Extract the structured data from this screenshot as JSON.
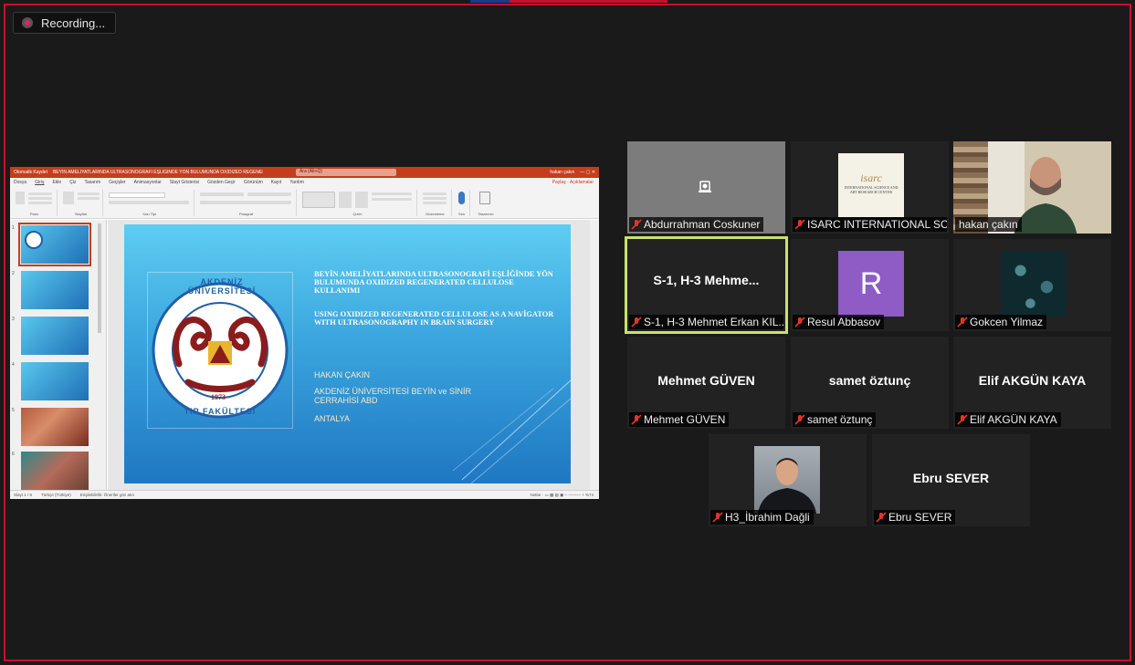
{
  "recording": {
    "label": "Recording..."
  },
  "colors": {
    "frame_border": "#c8102e",
    "recording_dot": "#e0245e",
    "speaker_highlight": "#c7e36a",
    "ppt_accent": "#c43e1c",
    "mute_icon": "#e5332a"
  },
  "shared_screen": {
    "app": "PowerPoint",
    "titlebar": {
      "autosave": "Otomatik Kaydet",
      "doc_title": "BEYİN AMELİYATLARINDA ULTRASONOGRAFİ EŞLİĞİNDE YÖN BULUMUNDA OXIDIZED REGENERATED - Bu bilgisayar konumuna kaydedildi",
      "search": "Ara (Alt+Q)",
      "user": "hakan çakın"
    },
    "menu": [
      "Dosya",
      "Giriş",
      "Ekle",
      "Çiz",
      "Tasarım",
      "Geçişler",
      "Animasyonlar",
      "Slayt Gösterisi",
      "Gözden Geçir",
      "Görünüm",
      "Kayıt",
      "Yardım"
    ],
    "share_label": "Paylaş",
    "comments_label": "Açıklamalar",
    "ribbon_groups": [
      "Pano",
      "Slaytlar",
      "Yazı Tipi",
      "Paragraf",
      "Çizim",
      "Düzenleme",
      "Ses",
      "Tasarımcı"
    ],
    "slide_numbers": [
      "1",
      "2",
      "3",
      "4",
      "5",
      "6"
    ],
    "slide": {
      "heading_tr": "BEYİN AMELİYATLARINDA ULTRASONOGRAFİ EŞLİĞİNDE YÖN BULUMUNDA OXIDIZED REGENERATED CELLULOSE KULLANIMI",
      "heading_en": "USING OXIDIZED REGENERATED CELLULOSE AS A NAVİGATOR WITH ULTRASONOGRAPHY IN BRAIN SURGERY",
      "author": "HAKAN ÇAKIN",
      "department": "AKDENİZ ÜNİVERSİTESİ BEYİN ve SİNİR CERRAHİSİ ABD",
      "city": "ANTALYA",
      "logo_top": "AKDENİZ ÜNİVERSİTESİ",
      "logo_bottom": "TIP FAKÜLTESİ",
      "logo_year": "1973"
    },
    "status": {
      "slide_count": "Slayt 1 / 6",
      "language": "Türkçe (Türkiye)",
      "accessibility": "Erişilebilirlik: Öneriler göz atın",
      "notes": "Notlar",
      "zoom": "%74"
    }
  },
  "participants": [
    {
      "id": "abdurrahman",
      "label": "Abdurrahman Coskuner",
      "muted": true
    },
    {
      "id": "isarc",
      "label": "ISARC INTERNATIONAL SCI...",
      "muted": true,
      "logo_text": "isarc",
      "logo_sub": "INTERNATIONAL SCIENCE AND ART RESEARCH CENTER"
    },
    {
      "id": "hakan",
      "label": "hakan çakın",
      "muted": false
    },
    {
      "id": "mehmet-erkan",
      "center": "S-1, H-3  Mehme...",
      "label": "S-1, H-3 Mehmet Erkan KIL...",
      "muted": true,
      "speaking": true
    },
    {
      "id": "resul",
      "label": "Resul Abbasov",
      "muted": true,
      "initial": "R"
    },
    {
      "id": "gokcen",
      "label": "Gokcen Yilmaz",
      "muted": true
    },
    {
      "id": "mehmet-guven",
      "center": "Mehmet GÜVEN",
      "label": "Mehmet GÜVEN",
      "muted": true
    },
    {
      "id": "samet",
      "center": "samet öztunç",
      "label": "samet öztunç",
      "muted": true
    },
    {
      "id": "elif",
      "center": "Elif AKGÜN KAYA",
      "label": "Elif AKGÜN KAYA",
      "muted": true
    },
    {
      "id": "ibrahim",
      "label": "H3_İbrahim Dağli",
      "muted": true
    },
    {
      "id": "ebru",
      "center": "Ebru SEVER",
      "label": "Ebru SEVER",
      "muted": true
    }
  ]
}
